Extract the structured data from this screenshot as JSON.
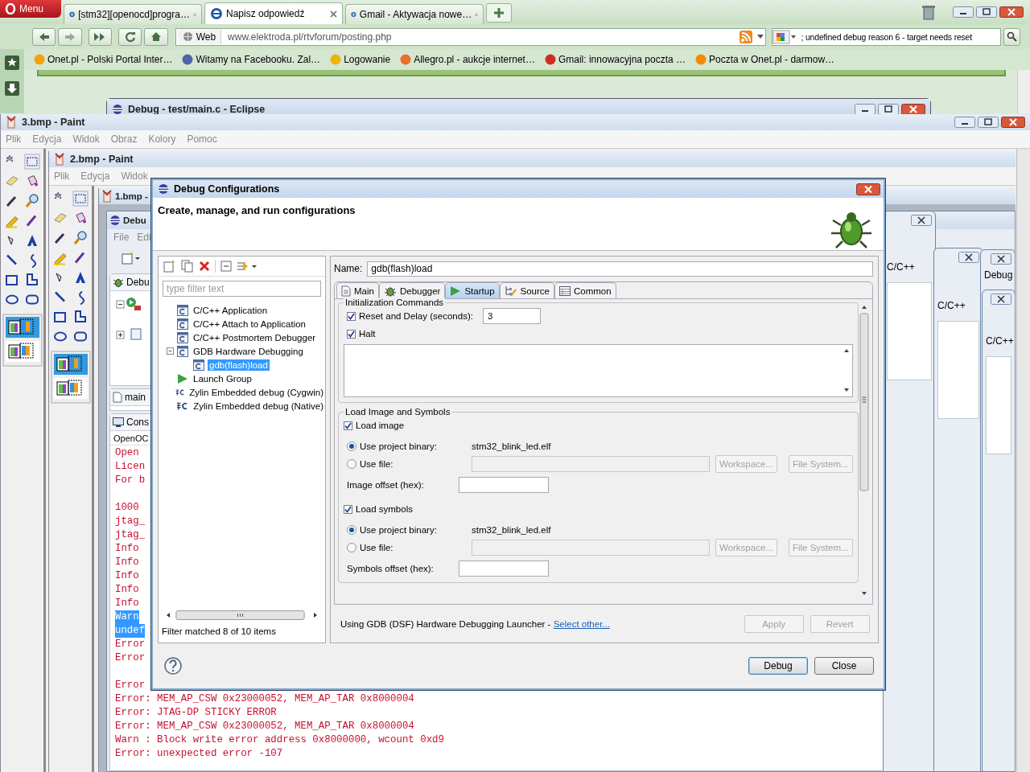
{
  "browser": {
    "menu_label": "Menu",
    "tabs": [
      {
        "title": "[stm32][openocd]progra…",
        "selected": false
      },
      {
        "title": "Napisz odpowiedź",
        "selected": true
      },
      {
        "title": "Gmail - Aktywacja nowe…",
        "selected": false
      }
    ],
    "search_engine": "Web",
    "address": "www.elektroda.pl/rtvforum/posting.php",
    "search_value": "; undefined debug reason 6 - target needs reset",
    "bookmarks": [
      {
        "label": "Onet.pl - Polski Portal Inter…",
        "color": "#f4a20c"
      },
      {
        "label": "Witamy na Facebooku. Zal…",
        "color": "#4a66a8"
      },
      {
        "label": "Logowanie",
        "color": "#f0b400"
      },
      {
        "label": "Allegro.pl - aukcje internet…",
        "color": "#e8702a"
      },
      {
        "label": "Gmail: innowacyjna poczta …",
        "color": "#d22c20"
      },
      {
        "label": "Poczta w Onet.pl - darmow…",
        "color": "#f08c00"
      }
    ]
  },
  "eclipse_back": {
    "title": "Debug - test/main.c - Eclipse"
  },
  "paint_windows": [
    {
      "title": "3.bmp - Paint",
      "menu": [
        "Plik",
        "Edycja",
        "Widok",
        "Obraz",
        "Kolory",
        "Pomoc"
      ]
    },
    {
      "title": "2.bmp - Paint",
      "menu": [
        "Plik",
        "Edycja",
        "Widok"
      ]
    },
    {
      "title": "1.bmp -"
    }
  ],
  "eclipse_window": {
    "title": "Debu",
    "menu": [
      "File",
      "Edi"
    ],
    "debug_tab": "Debu",
    "editor_tab": "main",
    "console_tab": "Cons",
    "console_name": "OpenOC",
    "console_lines": [
      {
        "kind": "text",
        "text": "Open",
        "selected": false
      },
      {
        "kind": "text",
        "text": "Licen",
        "selected": false
      },
      {
        "kind": "text",
        "text": "For b",
        "selected": false
      },
      {
        "kind": "blank"
      },
      {
        "kind": "text",
        "text": "1000",
        "selected": false
      },
      {
        "kind": "text",
        "text": "jtag_",
        "selected": false
      },
      {
        "kind": "text",
        "text": "jtag_",
        "selected": false
      },
      {
        "kind": "text",
        "text": "Info",
        "selected": false
      },
      {
        "kind": "text",
        "text": "Info",
        "selected": false
      },
      {
        "kind": "text",
        "text": "Info",
        "selected": false
      },
      {
        "kind": "text",
        "text": "Info",
        "selected": false
      },
      {
        "kind": "text",
        "text": "Info",
        "selected": false
      },
      {
        "kind": "text",
        "text": "Warn",
        "selected": true
      },
      {
        "kind": "text",
        "text": "undef",
        "selected": true
      },
      {
        "kind": "text",
        "text": "Error",
        "selected": false
      },
      {
        "kind": "text",
        "text": "Error",
        "selected": false
      },
      {
        "kind": "blank"
      },
      {
        "kind": "text",
        "text": "Error",
        "selected": false
      },
      {
        "kind": "text",
        "text": "Error: MEM_AP_CSW 0x23000052, MEM_AP_TAR 0x8000004",
        "selected": false
      },
      {
        "kind": "text",
        "text": "Error: JTAG-DP STICKY ERROR",
        "selected": false
      },
      {
        "kind": "text",
        "text": "Error: MEM_AP_CSW 0x23000052, MEM_AP_TAR 0x8000004",
        "selected": false
      },
      {
        "kind": "text",
        "text": "Warn : Block write error address 0x8000000, wcount 0xd9",
        "selected": false
      },
      {
        "kind": "text",
        "text": "Error: unexpected error -107",
        "selected": false
      }
    ]
  },
  "side_windows": [
    {
      "label": "C/C++"
    },
    {
      "label": "C/C++"
    },
    {
      "label": "Debug"
    },
    {
      "label": "C/C++"
    }
  ],
  "dialog": {
    "title": "Debug Configurations",
    "heading": "Create, manage, and run configurations",
    "filter_placeholder": "type filter text",
    "tree": [
      {
        "label": "C/C++ Application",
        "kind": "c-config",
        "selected": false
      },
      {
        "label": "C/C++ Attach to Application",
        "kind": "c-config",
        "selected": false
      },
      {
        "label": "C/C++ Postmortem Debugger",
        "kind": "c-config",
        "selected": false
      },
      {
        "label": "GDB Hardware Debugging",
        "kind": "c-config",
        "selected": false,
        "expanded": true,
        "children": [
          {
            "label": "gdb(flash)load",
            "kind": "c-config",
            "selected": true
          }
        ]
      },
      {
        "label": "Launch Group",
        "kind": "launch-group",
        "selected": false
      },
      {
        "label": "Zylin Embedded debug (Cygwin)",
        "kind": "zylin",
        "selected": false
      },
      {
        "label": "Zylin Embedded debug (Native)",
        "kind": "zylin",
        "selected": false
      }
    ],
    "filter_status": "Filter matched 8 of 10 items",
    "name_label": "Name:",
    "name_value": "gdb(flash)load",
    "tabs": [
      {
        "label": "Main",
        "kind": "main",
        "selected": false
      },
      {
        "label": "Debugger",
        "kind": "debugger",
        "selected": false
      },
      {
        "label": "Startup",
        "kind": "startup",
        "selected": true
      },
      {
        "label": "Source",
        "kind": "source",
        "selected": false
      },
      {
        "label": "Common",
        "kind": "common",
        "selected": false
      }
    ],
    "init_group": {
      "title": "Initialization Commands",
      "reset_label": "Reset and Delay (seconds):",
      "reset_checked": true,
      "reset_value": "3",
      "halt_label": "Halt",
      "halt_checked": true
    },
    "load_group": {
      "title": "Load Image and Symbols",
      "sections": [
        {
          "label": "Load image",
          "checked": true,
          "binary_label": "Use project binary:",
          "binary_selected": true,
          "binary_value": "stm32_blink_led.elf",
          "file_label": "Use file:",
          "file_selected": false,
          "buttons": [
            {
              "label": "Workspace...",
              "disabled": true
            },
            {
              "label": "File System...",
              "disabled": true
            }
          ],
          "offset_label": "Image offset (hex):"
        },
        {
          "label": "Load symbols",
          "checked": true,
          "binary_label": "Use project binary:",
          "binary_selected": true,
          "binary_value": "stm32_blink_led.elf",
          "file_label": "Use file:",
          "file_selected": false,
          "buttons": [
            {
              "label": "Workspace...",
              "disabled": true
            },
            {
              "label": "File System...",
              "disabled": true
            }
          ],
          "offset_label": "Symbols offset (hex):"
        }
      ]
    },
    "launcher_text": "Using GDB (DSF) Hardware Debugging Launcher -",
    "launcher_link": "Select other...",
    "apply": {
      "label": "Apply",
      "disabled": true
    },
    "revert": {
      "label": "Revert",
      "disabled": true
    },
    "buttons": [
      {
        "label": "Debug",
        "kind": "default"
      },
      {
        "label": "Close",
        "kind": "normal"
      }
    ]
  }
}
